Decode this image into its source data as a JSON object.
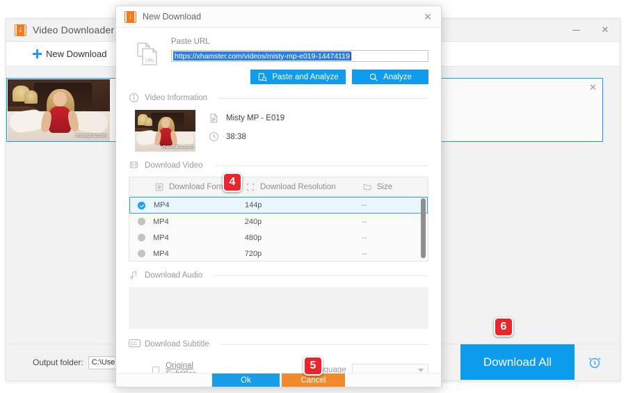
{
  "main_window": {
    "title": "Video Downloader",
    "logo_icon": "video-downloader-logo-icon",
    "minimize_icon": "minimize-icon",
    "close_icon": "close-icon",
    "toolbar": {
      "new_download_label": "New Download",
      "plus_icon": "plus-icon"
    },
    "card": {
      "close_icon": "close-icon",
      "thumbnail_watermark": "mompov.com"
    },
    "footer": {
      "output_folder_label": "Output folder:",
      "output_folder_value": "C:\\Users\\Wonde",
      "download_all_label": "Download All",
      "alarm_icon": "alarm-clock-icon"
    }
  },
  "dialog": {
    "title": "New Download",
    "logo_icon": "video-downloader-logo-icon",
    "close_icon": "close-icon",
    "url_section": {
      "icon": "url-file-icon",
      "label": "Paste URL",
      "value": "https://xhamster.com/videos/misty-mp-e019-14474119",
      "paste_and_analyze_label": "Paste and Analyze",
      "paste_icon": "paste-search-icon",
      "analyze_label": "Analyze",
      "analyze_icon": "search-icon"
    },
    "video_information": {
      "icon": "info-icon",
      "label": "Video Information",
      "title_icon": "document-icon",
      "title": "Misty MP - E019",
      "duration_icon": "clock-icon",
      "duration": "38:38",
      "thumbnail_watermark": "mompov.com"
    },
    "download_video": {
      "icon": "video-icon",
      "label": "Download Video",
      "columns": [
        {
          "label": "Download Format",
          "icon": "format-icon"
        },
        {
          "label": "Download Resolution",
          "icon": "resolution-icon"
        },
        {
          "label": "Size",
          "icon": "folder-icon"
        }
      ],
      "rows": [
        {
          "selected": true,
          "format": "MP4",
          "resolution": "144p",
          "size": "--"
        },
        {
          "selected": false,
          "format": "MP4",
          "resolution": "240p",
          "size": "--"
        },
        {
          "selected": false,
          "format": "MP4",
          "resolution": "480p",
          "size": "--"
        },
        {
          "selected": false,
          "format": "MP4",
          "resolution": "720p",
          "size": "--"
        }
      ]
    },
    "download_audio": {
      "icon": "music-note-icon",
      "label": "Download Audio"
    },
    "download_subtitle": {
      "icon": "closed-caption-icon",
      "label": "Download Subtitle",
      "original_subtitles_label": "Original Subtitles",
      "original_subtitles_checked": false,
      "language_label": "Language",
      "language_value": "",
      "dropdown_icon": "chevron-down-icon"
    },
    "footer": {
      "ok_label": "Ok",
      "cancel_label": "Cancel"
    }
  },
  "badges": [
    {
      "number": "4"
    },
    {
      "number": "5"
    },
    {
      "number": "6"
    }
  ],
  "colors": {
    "accent_blue": "#109cee",
    "accent_orange": "#f2892b",
    "brand_orange": "#f07c1f",
    "badge_red": "#e8262b",
    "selection_blue": "#2f7fe0"
  }
}
